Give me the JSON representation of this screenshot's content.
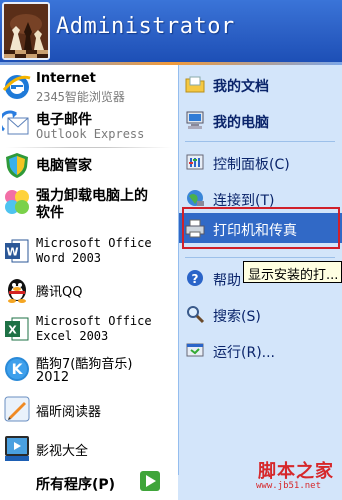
{
  "user": {
    "name": "Administrator"
  },
  "left": {
    "pinned": [
      {
        "title": "Internet",
        "subtitle": "2345智能浏览器",
        "icon": "ie-browser-icon"
      },
      {
        "title": "电子邮件",
        "subtitle": "Outlook Express",
        "icon": "outlook-express-icon"
      }
    ],
    "programs": [
      {
        "line1": "电脑管家",
        "icon": "computer-manager-shield-icon"
      },
      {
        "line1": "强力卸载电脑上的",
        "line2": "软件",
        "icon": "uninstaller-clover-icon"
      },
      {
        "line1": "Microsoft Office",
        "line2": "Word 2003",
        "icon": "word-icon"
      },
      {
        "line1": "腾讯QQ",
        "icon": "qq-penguin-icon"
      },
      {
        "line1": "Microsoft Office",
        "line2": "Excel 2003",
        "icon": "excel-icon"
      },
      {
        "line1": "酷狗7(酷狗音乐)",
        "line2": "2012",
        "icon": "kugou-icon"
      },
      {
        "line1": "福昕阅读器",
        "icon": "foxit-reader-icon"
      },
      {
        "line1": "影视大全",
        "icon": "video-player-icon"
      }
    ],
    "all_programs": "所有程序(P)"
  },
  "right": {
    "items": [
      {
        "label": "我的文档",
        "icon": "my-documents-icon",
        "bold": true
      },
      {
        "label": "我的电脑",
        "icon": "my-computer-icon",
        "bold": true
      },
      {
        "label": "控制面板(C)",
        "icon": "control-panel-icon",
        "bold": false
      },
      {
        "label": "连接到(T)",
        "icon": "connect-to-icon",
        "bold": false
      },
      {
        "label": "打印机和传真",
        "icon": "printer-icon",
        "bold": false,
        "highlighted": true
      },
      {
        "label": "帮助",
        "icon": "help-icon",
        "bold": false
      },
      {
        "label": "搜索(S)",
        "icon": "search-icon",
        "bold": false
      },
      {
        "label": "运行(R)...",
        "icon": "run-icon",
        "bold": false
      }
    ]
  },
  "tooltip": "显示安装的打...",
  "watermark": {
    "line1": "脚本之家",
    "line2": "www.jb51.net"
  },
  "colors": {
    "header_blue": "#2e63c8",
    "highlight": "#3169c6",
    "right_panel": "#d3e5fa",
    "red_box": "#d0202a"
  }
}
